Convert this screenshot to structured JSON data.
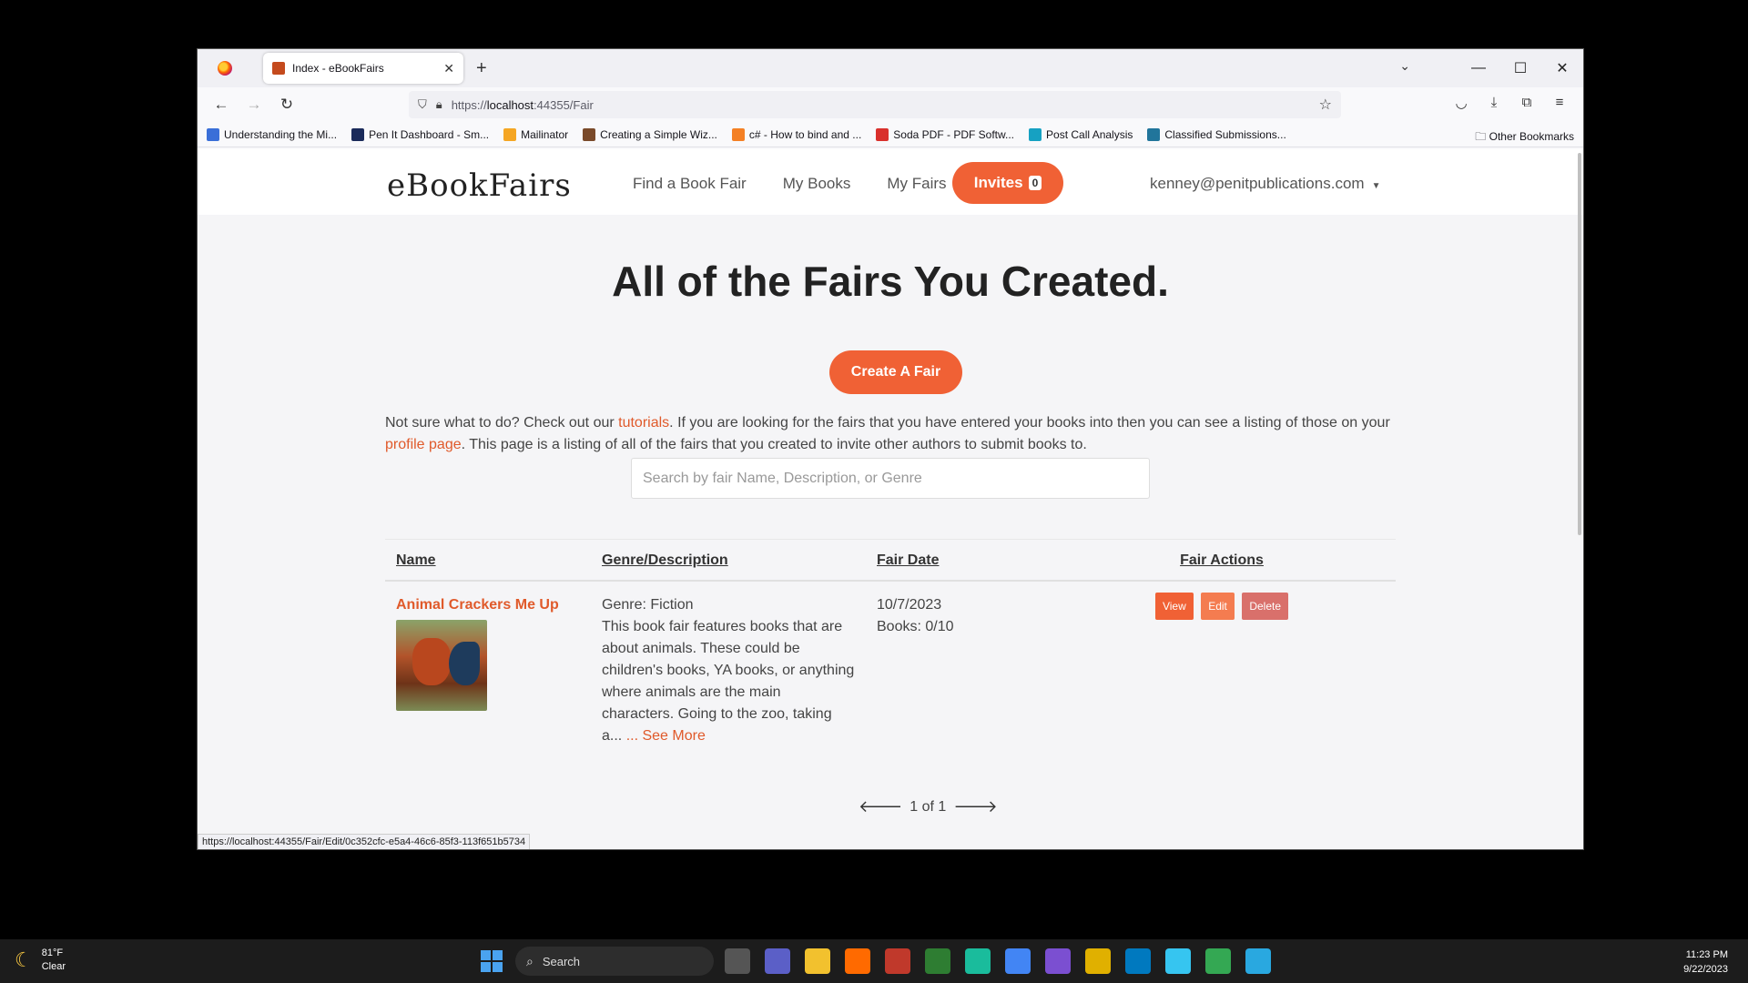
{
  "browser": {
    "tab_title": "Index - eBookFairs",
    "url_prefix": "https://",
    "url_host": "localhost",
    "url_rest": ":44355/Fair",
    "bookmarks": [
      {
        "label": "Understanding the Mi...",
        "color": "#3a6fd8"
      },
      {
        "label": "Pen It Dashboard - Sm...",
        "color": "#1a2a5a"
      },
      {
        "label": "Mailinator",
        "color": "#f5a623"
      },
      {
        "label": "Creating a Simple Wiz...",
        "color": "#7a4a2a"
      },
      {
        "label": "c# - How to bind and ...",
        "color": "#f48024"
      },
      {
        "label": "Soda PDF - PDF Softw...",
        "color": "#d9302c"
      },
      {
        "label": "Post Call Analysis",
        "color": "#16a1c2"
      },
      {
        "label": "Classified Submissions...",
        "color": "#21759b"
      }
    ],
    "other_bookmarks": "Other Bookmarks",
    "status_url": "https://localhost:44355/Fair/Edit/0c352cfc-e5a4-46c6-85f3-113f651b5734"
  },
  "site": {
    "logo_text": "eBookFairs",
    "nav": [
      "Find a Book Fair",
      "My Books",
      "My Fairs"
    ],
    "invites_label": "Invites",
    "invites_count": "0",
    "user_email": "kenney@penitpublications.com"
  },
  "main": {
    "title": "All of the Fairs You Created.",
    "create_button": "Create A Fair",
    "intro_part1": "Not sure what to do? Check out our ",
    "intro_link1": "tutorials",
    "intro_part2": ". If you are looking for the fairs that you have entered your books into then you can see a listing of those on your ",
    "intro_link2": "profile page",
    "intro_part3": ". This page is a listing of all of the fairs that you created to invite other authors to submit books to.",
    "search_placeholder": "Search by fair Name, Description, or Genre"
  },
  "table": {
    "headers": [
      "Name",
      "Genre/Description",
      "Fair Date",
      "Fair Actions"
    ],
    "rows": [
      {
        "name": "Animal Crackers Me Up",
        "genre": "Genre: Fiction",
        "description": "This book fair features books that are about animals. These could be children's books, YA books, or anything where animals are the main characters. Going to the zoo, taking a...",
        "see_more": "... See More",
        "date": "10/7/2023",
        "books": "Books: 0/10",
        "actions": [
          "View",
          "Edit",
          "Delete"
        ]
      }
    ]
  },
  "pager": {
    "text": "1 of 1"
  },
  "taskbar": {
    "temperature": "81°F",
    "condition": "Clear",
    "search_label": "Search",
    "time": "11:23 PM",
    "date": "9/22/2023"
  },
  "colors": {
    "accent": "#f06135",
    "link": "#e05a2b"
  }
}
